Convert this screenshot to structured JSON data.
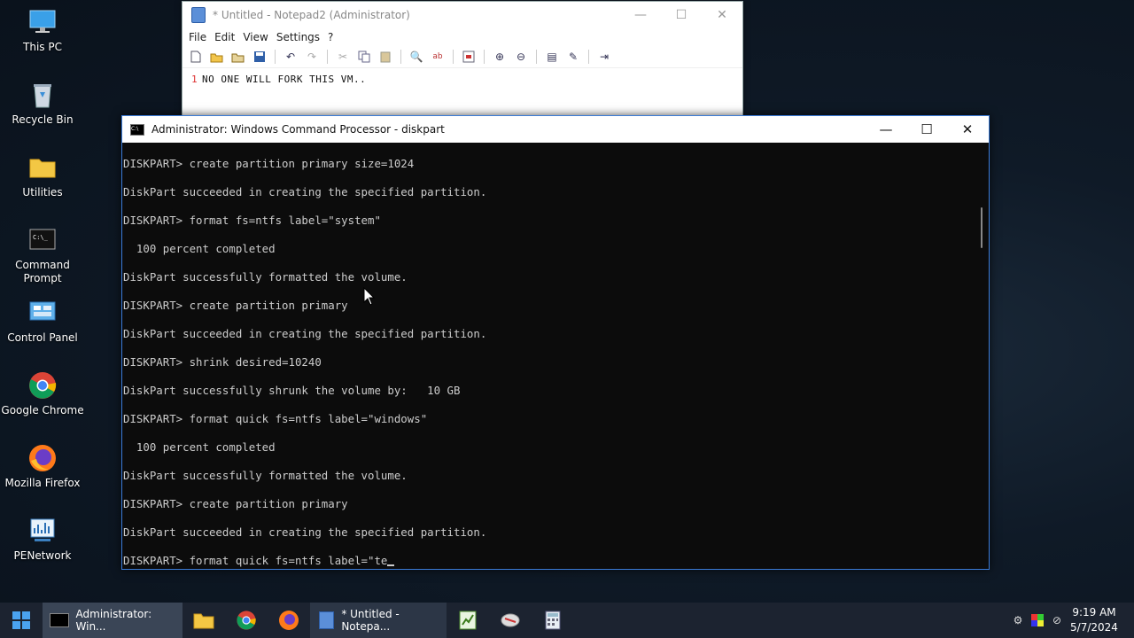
{
  "desktop": {
    "icons": [
      {
        "label": "This PC",
        "icon": "computer-icon"
      },
      {
        "label": "Recycle Bin",
        "icon": "recycle-bin-icon"
      },
      {
        "label": "Utilities",
        "icon": "folder-icon"
      },
      {
        "label": "Command Prompt",
        "icon": "terminal-icon"
      },
      {
        "label": "Control Panel",
        "icon": "control-panel-icon"
      },
      {
        "label": "Google Chrome",
        "icon": "chrome-icon"
      },
      {
        "label": "Mozilla Firefox",
        "icon": "firefox-icon"
      },
      {
        "label": "PENetwork",
        "icon": "network-icon"
      }
    ]
  },
  "notepad": {
    "title": "* Untitled - Notepad2 (Administrator)",
    "menu": [
      "File",
      "Edit",
      "View",
      "Settings",
      "?"
    ],
    "line_number": "1",
    "text": "NO ONE WILL FORK THIS VM.."
  },
  "cmd": {
    "title": "Administrator: Windows Command Processor - diskpart",
    "lines": [
      "DISKPART> create partition primary size=1024",
      "",
      "DiskPart succeeded in creating the specified partition.",
      "",
      "DISKPART> format fs=ntfs label=\"system\"",
      "",
      "  100 percent completed",
      "",
      "DiskPart successfully formatted the volume.",
      "",
      "DISKPART> create partition primary",
      "",
      "DiskPart succeeded in creating the specified partition.",
      "",
      "DISKPART> shrink desired=10240",
      "",
      "DiskPart successfully shrunk the volume by:   10 GB",
      "",
      "DISKPART> format quick fs=ntfs label=\"windows\"",
      "",
      "  100 percent completed",
      "",
      "DiskPart successfully formatted the volume.",
      "",
      "DISKPART> create partition primary",
      "",
      "DiskPart succeeded in creating the specified partition.",
      "",
      "DISKPART> format quick fs=ntfs label=\"te"
    ]
  },
  "taskbar": {
    "cmd_task_label": "Administrator: Win...",
    "notepad_task_label": "* Untitled - Notepa...",
    "time": "9:19 AM",
    "date": "5/7/2024"
  },
  "colors": {
    "accent": "#3b7bd6",
    "console_bg": "#0c0c0c",
    "console_fg": "#cccccc",
    "taskbar": "#1c2330"
  }
}
